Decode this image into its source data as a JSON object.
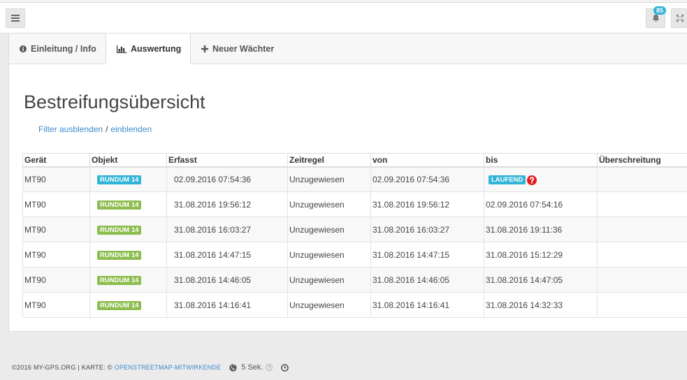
{
  "topbar": {
    "menu_icon": "bars-icon",
    "notification_icon": "bell-icon",
    "notification_count": "85",
    "fullscreen_icon": "expand-icon"
  },
  "tabs": [
    {
      "label": "Einleitung / Info",
      "icon": "info-circle-icon",
      "active": false
    },
    {
      "label": "Auswertung",
      "icon": "bar-chart-icon",
      "active": true
    },
    {
      "label": "Neuer Wächter",
      "icon": "plus-icon",
      "active": false
    }
  ],
  "page": {
    "title": "Bestreifungsübersicht",
    "filter_hide_link": "Filter ausblenden",
    "filter_separator": "/",
    "filter_show_link": "einblenden"
  },
  "table": {
    "columns": [
      "Gerät",
      "Objekt",
      "Erfasst",
      "Zeitregel",
      "von",
      "bis",
      "Überschreitung"
    ],
    "rows": [
      {
        "device": "MT90",
        "object": "RUNDUM 14",
        "object_label_color": "#2fb4d8",
        "recorded": "02.09.2016 07:54:36",
        "time_rule": "Unzugewiesen",
        "from": "02.09.2016 07:54:36",
        "status": "LAUFEND",
        "status_color": "#2fb4d8",
        "status_icon": "question-circle-icon"
      },
      {
        "device": "MT90",
        "object": "RUNDUM 14",
        "object_label_color": "#8cbd4e",
        "recorded": "31.08.2016 19:56:12",
        "time_rule": "Unzugewiesen",
        "from": "31.08.2016 19:56:12",
        "to": "02.09.2016 07:54:16"
      },
      {
        "device": "MT90",
        "object": "RUNDUM 14",
        "object_label_color": "#8cbd4e",
        "recorded": "31.08.2016 16:03:27",
        "time_rule": "Unzugewiesen",
        "from": "31.08.2016 16:03:27",
        "to": "31.08.2016 19:11:36"
      },
      {
        "device": "MT90",
        "object": "RUNDUM 14",
        "object_label_color": "#8cbd4e",
        "recorded": "31.08.2016 14:47:15",
        "time_rule": "Unzugewiesen",
        "from": "31.08.2016 14:47:15",
        "to": "31.08.2016 15:12:29"
      },
      {
        "device": "MT90",
        "object": "RUNDUM 14",
        "object_label_color": "#8cbd4e",
        "recorded": "31.08.2016 14:46:05",
        "time_rule": "Unzugewiesen",
        "from": "31.08.2016 14:46:05",
        "to": "31.08.2016 14:47:05"
      },
      {
        "device": "MT90",
        "object": "RUNDUM 14",
        "object_label_color": "#8cbd4e",
        "recorded": "31.08.2016 14:16:41",
        "time_rule": "Unzugewiesen",
        "from": "31.08.2016 14:16:41",
        "to": "31.08.2016 14:32:33"
      }
    ]
  },
  "footer": {
    "copyright": "©2016 MY-GPS.ORG | KARTE: ©",
    "map_credit_link": "OPENSTREETMAP-MITWIRKENDE",
    "globe_icon": "globe-icon",
    "refresh_interval": "5 Sek.",
    "help_icon": "question-circle-icon",
    "clock_icon": "clock-icon"
  },
  "colors": {
    "primary_teal": "#2fb4d8",
    "success_green": "#8cbd4e",
    "link_blue": "#3a8bcd",
    "danger_red": "#e21b1b"
  }
}
